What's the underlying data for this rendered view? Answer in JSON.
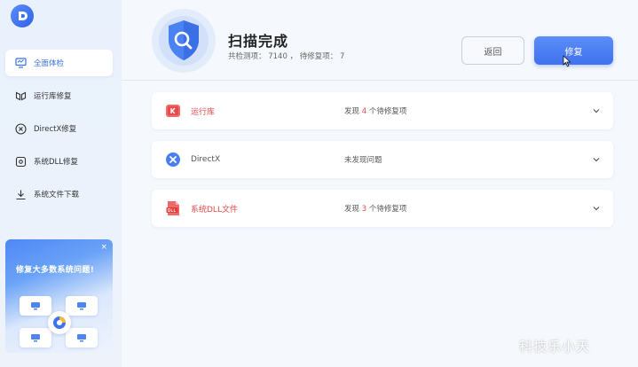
{
  "app": {
    "brand_name": ""
  },
  "sidebar": {
    "items": [
      {
        "label": "全面体检",
        "icon": "monitor-icon",
        "active": true
      },
      {
        "label": "运行库修复",
        "icon": "cube-icon",
        "active": false
      },
      {
        "label": "DirectX修复",
        "icon": "x-circle-icon",
        "active": false
      },
      {
        "label": "系统DLL修复",
        "icon": "dll-icon",
        "active": false
      },
      {
        "label": "系统文件下载",
        "icon": "download-icon",
        "active": false
      }
    ],
    "promo": {
      "title": "修复大多数系统问题!",
      "close": "×"
    }
  },
  "header": {
    "title": "扫描完成",
    "summary_prefix": "共检测项：",
    "total": "7140",
    "summary_sep": "，  待修复项：",
    "pending": "7"
  },
  "buttons": {
    "back": "返回",
    "fix": "修复"
  },
  "results": [
    {
      "name": "运行库",
      "status_prefix": "发现 ",
      "count": "4",
      "status_suffix": " 个待修复项",
      "icon": "runtime-icon",
      "has_issue": true
    },
    {
      "name": "DirectX",
      "status": "未发现问题",
      "icon": "x-circle-icon",
      "has_issue": false
    },
    {
      "name": "系统DLL文件",
      "status_prefix": "发现 ",
      "count": "3",
      "status_suffix": " 个待修复项",
      "icon": "dll-file-icon",
      "has_issue": true
    }
  ],
  "watermark": "科技乐小天",
  "colors": {
    "accent": "#3f72ee",
    "danger": "#e14b4b",
    "background": "#f5f8fd"
  }
}
